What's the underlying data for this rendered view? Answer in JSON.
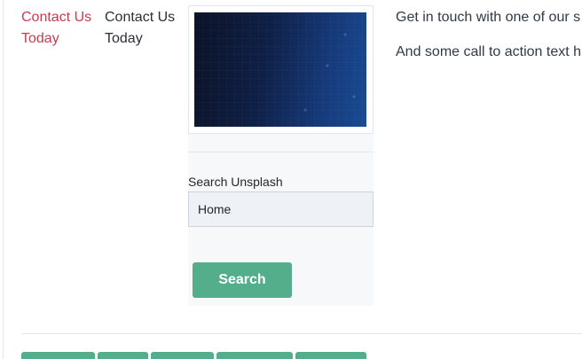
{
  "left_column": {
    "link_text": "Contact Us Today"
  },
  "middle_column": {
    "text": "Contact Us Today"
  },
  "image_panel": {
    "image_alt": "Dark blue abstract technology background"
  },
  "search": {
    "label": "Search Unsplash",
    "value": "Home",
    "button_label": "Search"
  },
  "cta": {
    "line1": "Get in touch with one of our s",
    "line2": "And some call to action text h"
  },
  "colors": {
    "link": "#c93b4f",
    "accent_green": "#55ae8b",
    "text": "#2f3a48"
  }
}
